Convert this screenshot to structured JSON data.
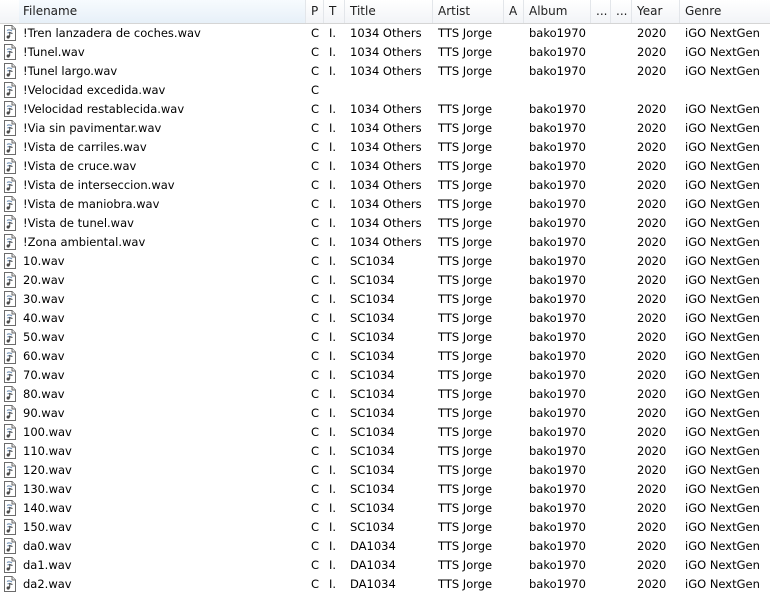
{
  "columns": {
    "filename": "Filename",
    "p": "P",
    "t": "T",
    "title": "Title",
    "artist": "Artist",
    "a": "A",
    "album": "Album",
    "d1": "...",
    "d2": "...",
    "year": "Year",
    "genre": "Genre"
  },
  "sort": {
    "column": "Filename",
    "indicator": "˄"
  },
  "icon": "audio-file-icon",
  "rows": [
    {
      "filename": "!Tren lanzadera de coches.wav",
      "p": "C",
      "t": "I.",
      "title": "1034 Others",
      "artist": "TTS Jorge",
      "album": "bako1970",
      "year": "2020",
      "genre": "iGO NextGen"
    },
    {
      "filename": "!Tunel.wav",
      "p": "C",
      "t": "I.",
      "title": "1034 Others",
      "artist": "TTS Jorge",
      "album": "bako1970",
      "year": "2020",
      "genre": "iGO NextGen"
    },
    {
      "filename": "!Tunel largo.wav",
      "p": "C",
      "t": "I.",
      "title": "1034 Others",
      "artist": "TTS Jorge",
      "album": "bako1970",
      "year": "2020",
      "genre": "iGO NextGen"
    },
    {
      "filename": "!Velocidad excedida.wav",
      "p": "C",
      "t": "",
      "title": "",
      "artist": "",
      "album": "",
      "year": "",
      "genre": ""
    },
    {
      "filename": "!Velocidad restablecida.wav",
      "p": "C",
      "t": "I.",
      "title": "1034 Others",
      "artist": "TTS Jorge",
      "album": "bako1970",
      "year": "2020",
      "genre": "iGO NextGen"
    },
    {
      "filename": "!Via sin pavimentar.wav",
      "p": "C",
      "t": "I.",
      "title": "1034 Others",
      "artist": "TTS Jorge",
      "album": "bako1970",
      "year": "2020",
      "genre": "iGO NextGen"
    },
    {
      "filename": "!Vista de carriles.wav",
      "p": "C",
      "t": "I.",
      "title": "1034 Others",
      "artist": "TTS Jorge",
      "album": "bako1970",
      "year": "2020",
      "genre": "iGO NextGen"
    },
    {
      "filename": "!Vista de cruce.wav",
      "p": "C",
      "t": "I.",
      "title": "1034 Others",
      "artist": "TTS Jorge",
      "album": "bako1970",
      "year": "2020",
      "genre": "iGO NextGen"
    },
    {
      "filename": "!Vista de interseccion.wav",
      "p": "C",
      "t": "I.",
      "title": "1034 Others",
      "artist": "TTS Jorge",
      "album": "bako1970",
      "year": "2020",
      "genre": "iGO NextGen"
    },
    {
      "filename": "!Vista de maniobra.wav",
      "p": "C",
      "t": "I.",
      "title": "1034 Others",
      "artist": "TTS Jorge",
      "album": "bako1970",
      "year": "2020",
      "genre": "iGO NextGen"
    },
    {
      "filename": "!Vista de tunel.wav",
      "p": "C",
      "t": "I.",
      "title": "1034 Others",
      "artist": "TTS Jorge",
      "album": "bako1970",
      "year": "2020",
      "genre": "iGO NextGen"
    },
    {
      "filename": "!Zona ambiental.wav",
      "p": "C",
      "t": "I.",
      "title": "1034 Others",
      "artist": "TTS Jorge",
      "album": "bako1970",
      "year": "2020",
      "genre": "iGO NextGen"
    },
    {
      "filename": "10.wav",
      "p": "C",
      "t": "I.",
      "title": "SC1034",
      "artist": "TTS Jorge",
      "album": "bako1970",
      "year": "2020",
      "genre": "iGO NextGen"
    },
    {
      "filename": "20.wav",
      "p": "C",
      "t": "I.",
      "title": "SC1034",
      "artist": "TTS Jorge",
      "album": "bako1970",
      "year": "2020",
      "genre": "iGO NextGen"
    },
    {
      "filename": "30.wav",
      "p": "C",
      "t": "I.",
      "title": "SC1034",
      "artist": "TTS Jorge",
      "album": "bako1970",
      "year": "2020",
      "genre": "iGO NextGen"
    },
    {
      "filename": "40.wav",
      "p": "C",
      "t": "I.",
      "title": "SC1034",
      "artist": "TTS Jorge",
      "album": "bako1970",
      "year": "2020",
      "genre": "iGO NextGen"
    },
    {
      "filename": "50.wav",
      "p": "C",
      "t": "I.",
      "title": "SC1034",
      "artist": "TTS Jorge",
      "album": "bako1970",
      "year": "2020",
      "genre": "iGO NextGen"
    },
    {
      "filename": "60.wav",
      "p": "C",
      "t": "I.",
      "title": "SC1034",
      "artist": "TTS Jorge",
      "album": "bako1970",
      "year": "2020",
      "genre": "iGO NextGen"
    },
    {
      "filename": "70.wav",
      "p": "C",
      "t": "I.",
      "title": "SC1034",
      "artist": "TTS Jorge",
      "album": "bako1970",
      "year": "2020",
      "genre": "iGO NextGen"
    },
    {
      "filename": "80.wav",
      "p": "C",
      "t": "I.",
      "title": "SC1034",
      "artist": "TTS Jorge",
      "album": "bako1970",
      "year": "2020",
      "genre": "iGO NextGen"
    },
    {
      "filename": "90.wav",
      "p": "C",
      "t": "I.",
      "title": "SC1034",
      "artist": "TTS Jorge",
      "album": "bako1970",
      "year": "2020",
      "genre": "iGO NextGen"
    },
    {
      "filename": "100.wav",
      "p": "C",
      "t": "I.",
      "title": "SC1034",
      "artist": "TTS Jorge",
      "album": "bako1970",
      "year": "2020",
      "genre": "iGO NextGen"
    },
    {
      "filename": "110.wav",
      "p": "C",
      "t": "I.",
      "title": "SC1034",
      "artist": "TTS Jorge",
      "album": "bako1970",
      "year": "2020",
      "genre": "iGO NextGen"
    },
    {
      "filename": "120.wav",
      "p": "C",
      "t": "I.",
      "title": "SC1034",
      "artist": "TTS Jorge",
      "album": "bako1970",
      "year": "2020",
      "genre": "iGO NextGen"
    },
    {
      "filename": "130.wav",
      "p": "C",
      "t": "I.",
      "title": "SC1034",
      "artist": "TTS Jorge",
      "album": "bako1970",
      "year": "2020",
      "genre": "iGO NextGen"
    },
    {
      "filename": "140.wav",
      "p": "C",
      "t": "I.",
      "title": "SC1034",
      "artist": "TTS Jorge",
      "album": "bako1970",
      "year": "2020",
      "genre": "iGO NextGen"
    },
    {
      "filename": "150.wav",
      "p": "C",
      "t": "I.",
      "title": "SC1034",
      "artist": "TTS Jorge",
      "album": "bako1970",
      "year": "2020",
      "genre": "iGO NextGen"
    },
    {
      "filename": "da0.wav",
      "p": "C",
      "t": "I.",
      "title": "DA1034",
      "artist": "TTS Jorge",
      "album": "bako1970",
      "year": "2020",
      "genre": "iGO NextGen"
    },
    {
      "filename": "da1.wav",
      "p": "C",
      "t": "I.",
      "title": "DA1034",
      "artist": "TTS Jorge",
      "album": "bako1970",
      "year": "2020",
      "genre": "iGO NextGen"
    },
    {
      "filename": "da2.wav",
      "p": "C",
      "t": "I.",
      "title": "DA1034",
      "artist": "TTS Jorge",
      "album": "bako1970",
      "year": "2020",
      "genre": "iGO NextGen"
    }
  ]
}
